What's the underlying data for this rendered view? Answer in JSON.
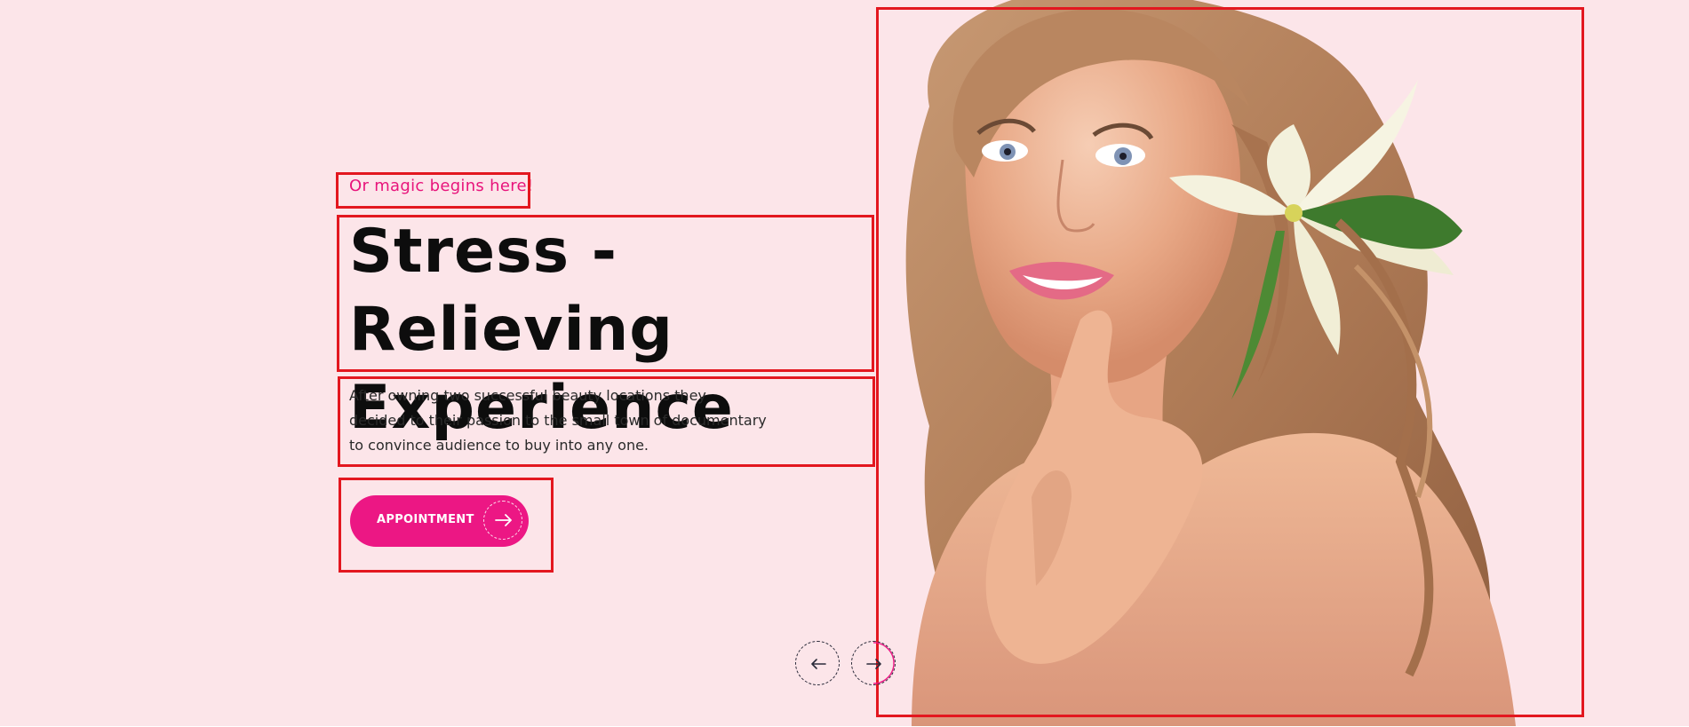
{
  "hero": {
    "eyebrow": "Or magic begins here!",
    "title_line1": "Stress - Relieving",
    "title_line2": "Experience",
    "description": "After owning two successful beauty locations they decided to their passion to the small town of documentary to convince audience to buy into any one.",
    "button_label": "APPOINTMENT",
    "image_alt": "Woman with lily flower in hair"
  },
  "icons": {
    "button_arrow": "arrow-right-icon",
    "prev_arrow": "arrow-left-icon",
    "next_arrow": "arrow-right-icon"
  },
  "colors": {
    "background": "#fce5e9",
    "accent": "#ec1784",
    "heading": "#0d0d0d",
    "annotation": "#e3171f"
  }
}
